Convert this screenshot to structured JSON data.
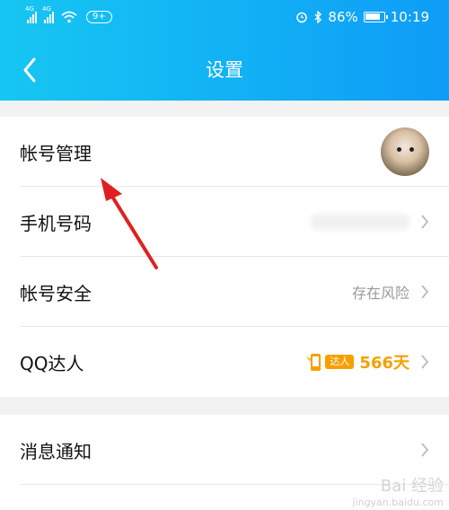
{
  "status_bar": {
    "net_tag_1": "4G",
    "net_tag_2": "4G",
    "notif_badge": "9+",
    "battery": "86%",
    "battery_level": 0.86,
    "time": "10:19"
  },
  "header": {
    "title": "设置",
    "back_icon": "chevron-left-icon"
  },
  "rows": {
    "account_manage": {
      "label": "帐号管理"
    },
    "phone": {
      "label": "手机号码"
    },
    "security": {
      "label": "帐号安全",
      "value": "存在风险"
    },
    "qq_master": {
      "label": "QQ达人",
      "badge": "达人",
      "days": "566天"
    },
    "notify": {
      "label": "消息通知"
    }
  },
  "watermark": {
    "logo": "Bai 经验",
    "url": "jingyan.baidu.com"
  },
  "colors": {
    "accent": "#12b0f5",
    "orange": "#f5a000",
    "arrow": "#e02020"
  }
}
